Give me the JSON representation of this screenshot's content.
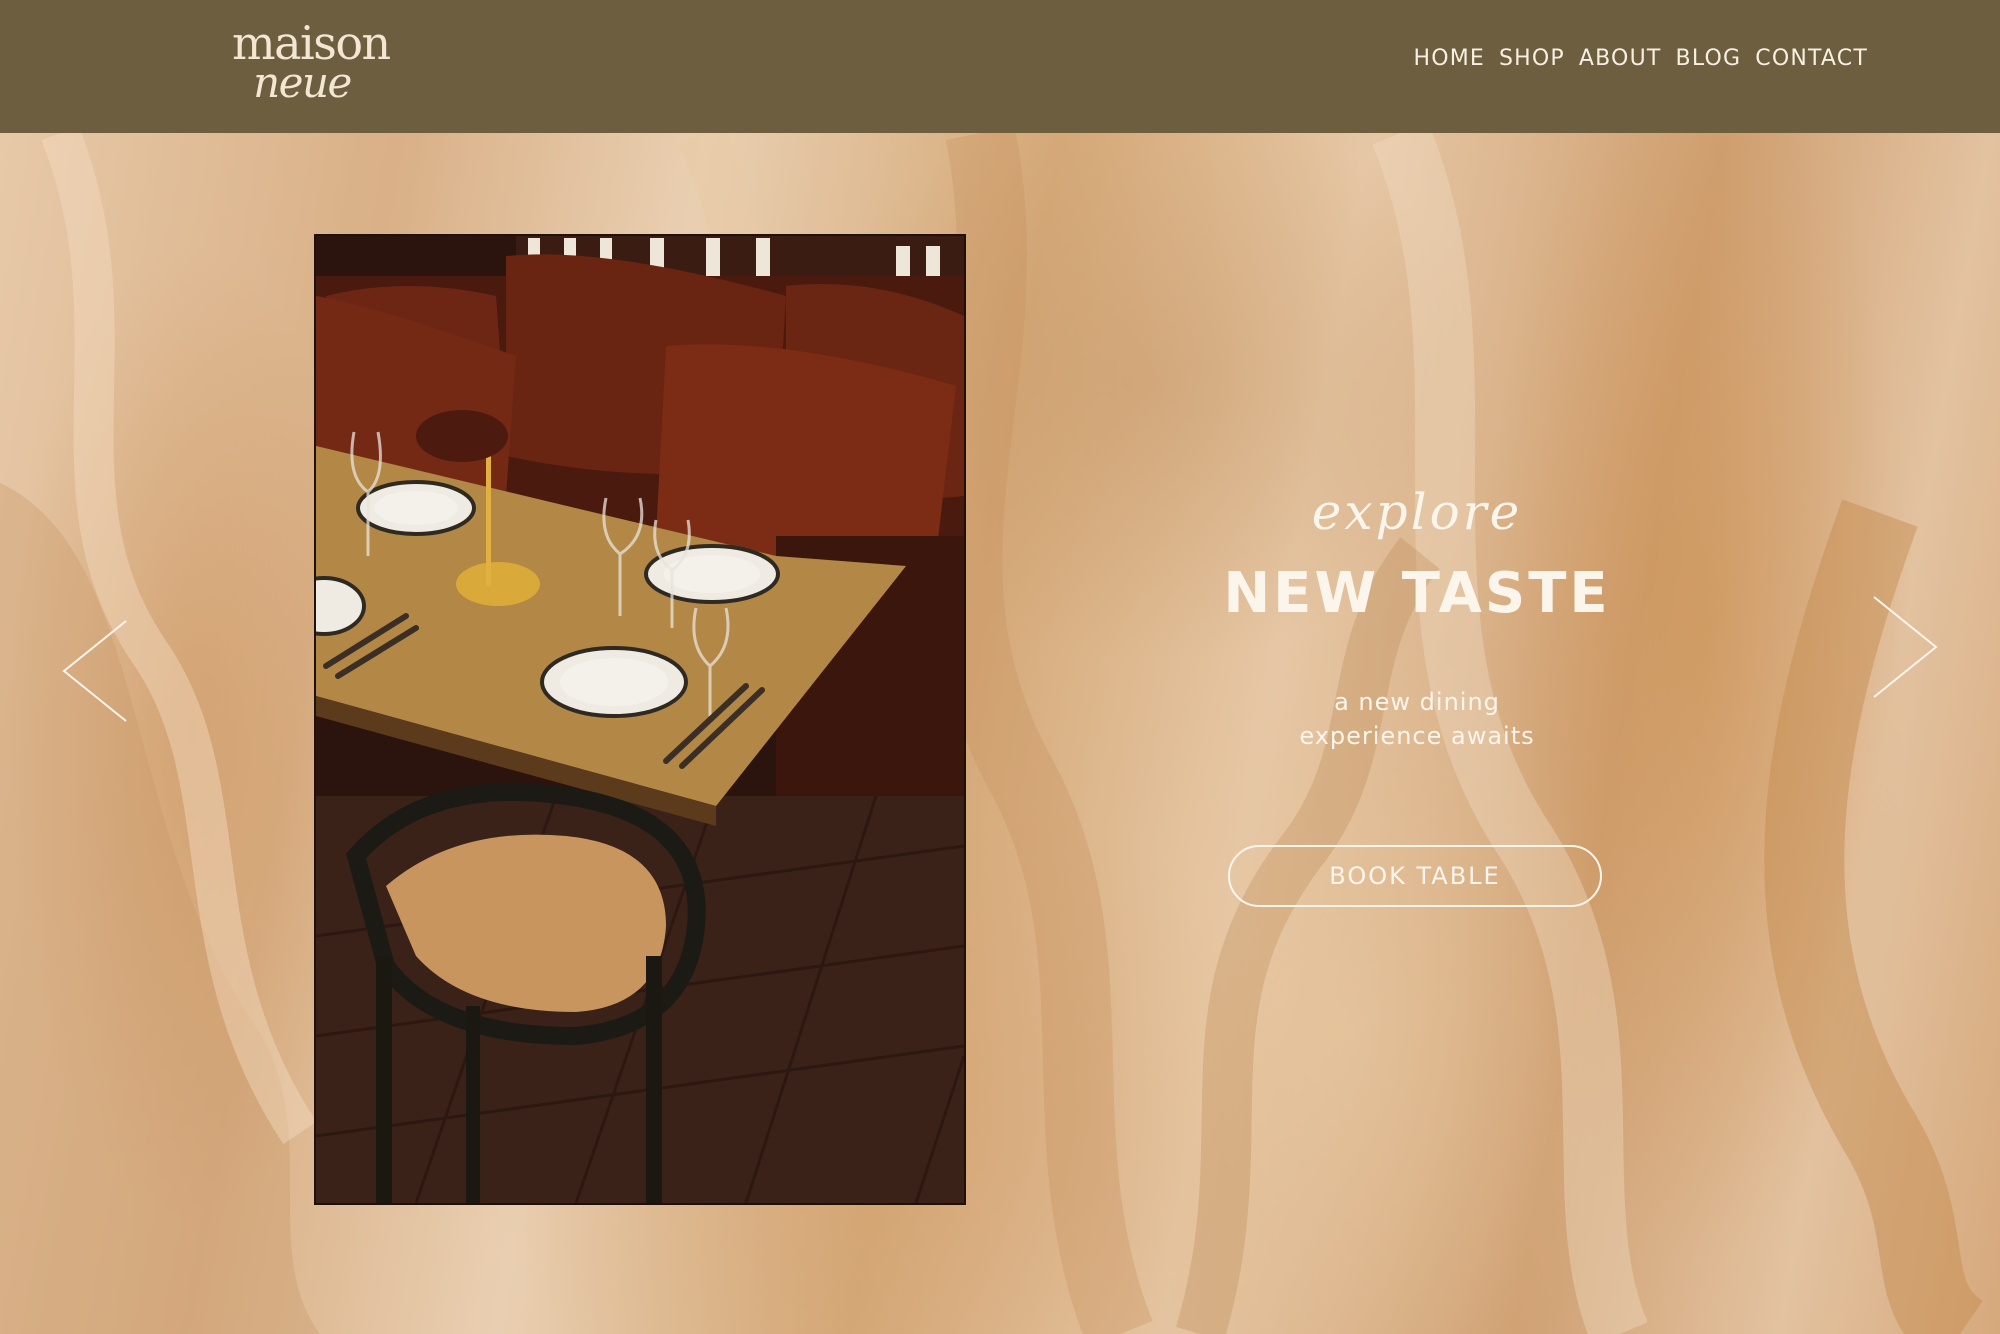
{
  "brand": {
    "logo_line1": "maison",
    "logo_line2": "neue"
  },
  "nav": {
    "items": [
      {
        "label": "HOME"
      },
      {
        "label": "SHOP"
      },
      {
        "label": "ABOUT"
      },
      {
        "label": "BLOG"
      },
      {
        "label": "CONTACT"
      }
    ]
  },
  "hero": {
    "eyebrow": "explore",
    "title": "NEW TASTE",
    "subtitle_line1": "a new dining",
    "subtitle_line2": "experience awaits",
    "cta_label": "BOOK TABLE",
    "prev_icon": "chevron-left-icon",
    "next_icon": "chevron-right-icon",
    "image_subject": "restaurant table setting"
  },
  "colors": {
    "header_bg": "#6c5e3f",
    "header_text": "#f7efe2",
    "hero_text": "#fbf5ec",
    "background_tone": "#d8b48e"
  }
}
